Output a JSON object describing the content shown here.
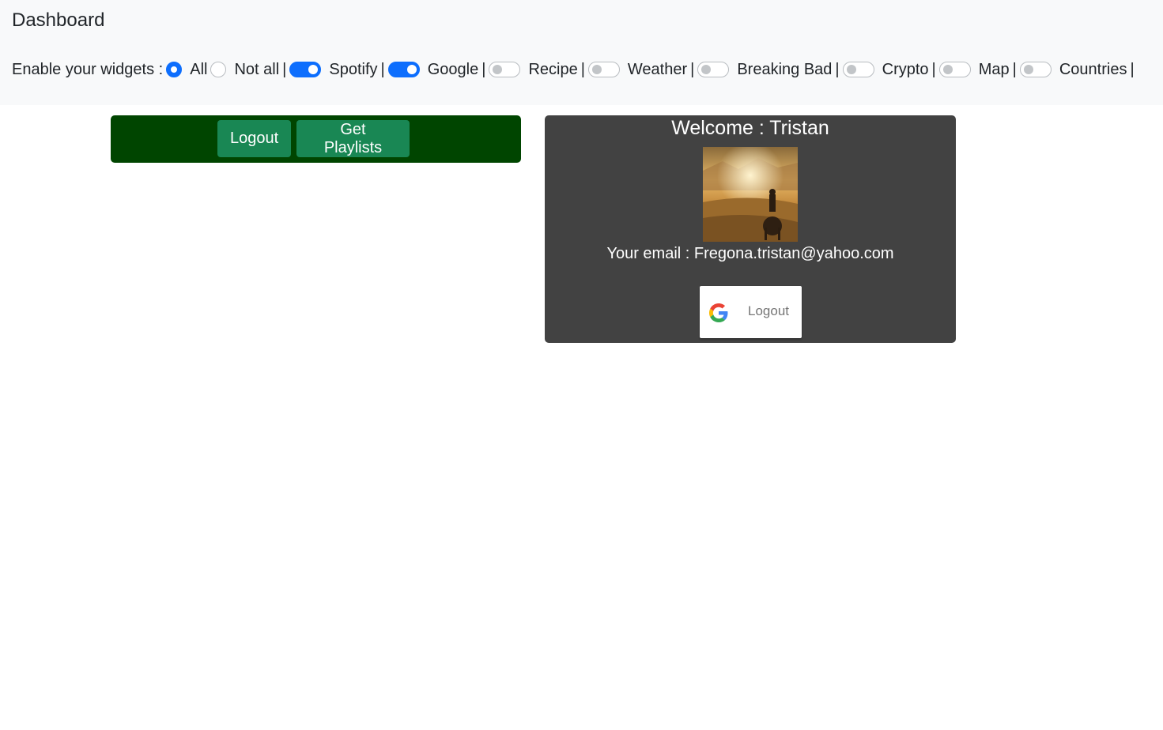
{
  "header": {
    "title": "Dashboard",
    "enable_label": "Enable your widgets :",
    "radio_all": "All",
    "radio_not_all": "Not all",
    "separator": "|",
    "selected_mode": "All",
    "widgets": [
      {
        "label": "Spotify",
        "enabled": true
      },
      {
        "label": "Google",
        "enabled": true
      },
      {
        "label": "Recipe",
        "enabled": false
      },
      {
        "label": "Weather",
        "enabled": false
      },
      {
        "label": "Breaking Bad",
        "enabled": false
      },
      {
        "label": "Crypto",
        "enabled": false
      },
      {
        "label": "Map",
        "enabled": false
      },
      {
        "label": "Countries",
        "enabled": false
      }
    ]
  },
  "spotify_widget": {
    "logout_label": "Logout",
    "get_playlists_label": "Get Playlists",
    "panel_color": "#004500",
    "button_color": "#198754"
  },
  "google_widget": {
    "welcome_text": "Welcome : Tristan",
    "email_text": "Your email : Fregona.tristan@yahoo.com",
    "logout_label": "Logout",
    "panel_color": "#424242",
    "avatar_alt": "profile-photo",
    "logout_icon": "google-g-icon"
  },
  "colors": {
    "toggle_on": "#0d6efd",
    "navbar_bg": "#f8f9fa"
  }
}
